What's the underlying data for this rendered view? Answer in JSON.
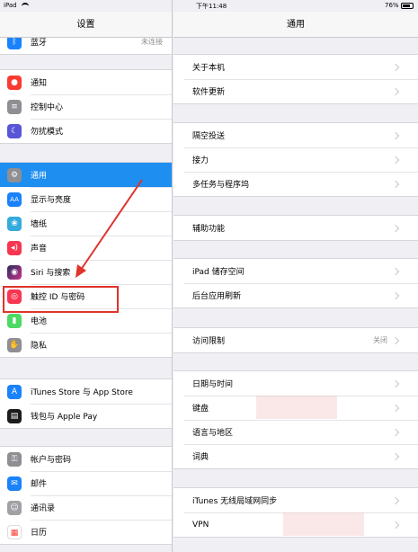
{
  "status_bar": {
    "device": "iPad",
    "time": "下午11:48",
    "battery": "76%"
  },
  "master": {
    "title": "设置",
    "groups": [
      [
        {
          "label": "蓝牙",
          "value": "未连接",
          "icon": "bluetooth-icon",
          "color": "#1a82fb"
        }
      ],
      [
        {
          "label": "通知",
          "icon": "notifications-icon",
          "color": "#f93b30"
        },
        {
          "label": "控制中心",
          "icon": "control-center-icon",
          "color": "#8e8e93"
        },
        {
          "label": "勿扰模式",
          "icon": "do-not-disturb-icon",
          "color": "#5856d6"
        }
      ],
      [
        {
          "label": "通用",
          "icon": "gear-icon",
          "color": "#8e8e93",
          "selected": true
        },
        {
          "label": "显示与亮度",
          "icon": "display-brightness-icon",
          "color": "#1a82fb"
        },
        {
          "label": "墙纸",
          "icon": "wallpaper-icon",
          "color": "#35aadc"
        },
        {
          "label": "声音",
          "icon": "sounds-icon",
          "color": "#f83651"
        },
        {
          "label": "Siri 与搜索",
          "icon": "siri-icon",
          "color": "#2c2c5e"
        },
        {
          "label": "触控 ID 与密码",
          "icon": "fingerprint-icon",
          "color": "#f83651"
        },
        {
          "label": "电池",
          "icon": "battery-icon",
          "color": "#4cd964"
        },
        {
          "label": "隐私",
          "icon": "privacy-hand-icon",
          "color": "#8e8e93"
        }
      ],
      [
        {
          "label": "iTunes Store 与 App Store",
          "icon": "app-store-icon",
          "color": "#1a82fb"
        },
        {
          "label": "钱包与 Apple Pay",
          "icon": "wallet-icon",
          "color": "#1c1c1e"
        }
      ],
      [
        {
          "label": "帐户与密码",
          "icon": "key-icon",
          "color": "#8e8e93"
        },
        {
          "label": "邮件",
          "icon": "mail-icon",
          "color": "#1a82fb"
        },
        {
          "label": "通讯录",
          "icon": "contacts-icon",
          "color": "#a0a0a5"
        },
        {
          "label": "日历",
          "icon": "calendar-icon",
          "color": "#ffffff"
        }
      ]
    ]
  },
  "detail": {
    "title": "通用",
    "groups": [
      [
        {
          "label": "关于本机"
        },
        {
          "label": "软件更新"
        }
      ],
      [
        {
          "label": "隔空投送"
        },
        {
          "label": "接力"
        },
        {
          "label": "多任务与程序坞"
        }
      ],
      [
        {
          "label": "辅助功能"
        }
      ],
      [
        {
          "label": "iPad 储存空间"
        },
        {
          "label": "后台应用刷新"
        }
      ],
      [
        {
          "label": "访问限制",
          "value": "关闭"
        }
      ],
      [
        {
          "label": "日期与时间"
        },
        {
          "label": "键盘"
        },
        {
          "label": "语言与地区"
        },
        {
          "label": "词典"
        }
      ],
      [
        {
          "label": "iTunes 无线局域网同步"
        },
        {
          "label": "VPN"
        }
      ]
    ]
  }
}
